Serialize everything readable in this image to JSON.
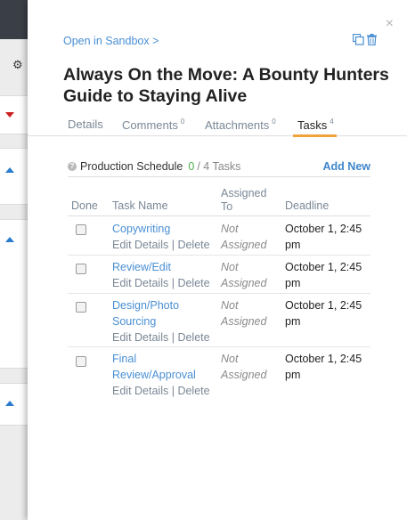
{
  "panel": {
    "sandbox_link": "Open in Sandbox >",
    "close_glyph": "×",
    "title": "Always On the Move: A Bounty Hunters Guide to Staying Alive"
  },
  "background": {
    "gear_glyph": "⚙"
  },
  "tabs": [
    {
      "label": "Details",
      "count": ""
    },
    {
      "label": "Comments",
      "count": "0"
    },
    {
      "label": "Attachments",
      "count": "0"
    },
    {
      "label": "Tasks",
      "count": "4"
    }
  ],
  "schedule": {
    "help_glyph": "?",
    "name": "Production Schedule",
    "done": "0",
    "total": "/ 4 Tasks",
    "add_new": "Add New"
  },
  "table": {
    "headers": {
      "done": "Done",
      "task_name": "Task Name",
      "assigned_to": "Assigned To",
      "deadline": "Deadline"
    },
    "edit_label": "Edit Details",
    "separator": "|",
    "delete_label": "Delete",
    "rows": [
      {
        "name": "Copywriting",
        "assigned": "Not Assigned",
        "deadline": "October 1, 2:45 pm",
        "checked": false
      },
      {
        "name": "Review/Edit",
        "assigned": "Not Assigned",
        "deadline": "October 1, 2:45 pm",
        "checked": false
      },
      {
        "name": "Design/Photo Sourcing",
        "assigned": "Not Assigned",
        "deadline": "October 1, 2:45 pm",
        "checked": false
      },
      {
        "name": "Final Review/Approval",
        "assigned": "Not Assigned",
        "deadline": "October 1, 2:45 pm",
        "checked": false
      }
    ]
  },
  "colors": {
    "link": "#4a8fd3",
    "active_tab_underline": "#f0a33a",
    "done_count": "#4cae4c"
  }
}
